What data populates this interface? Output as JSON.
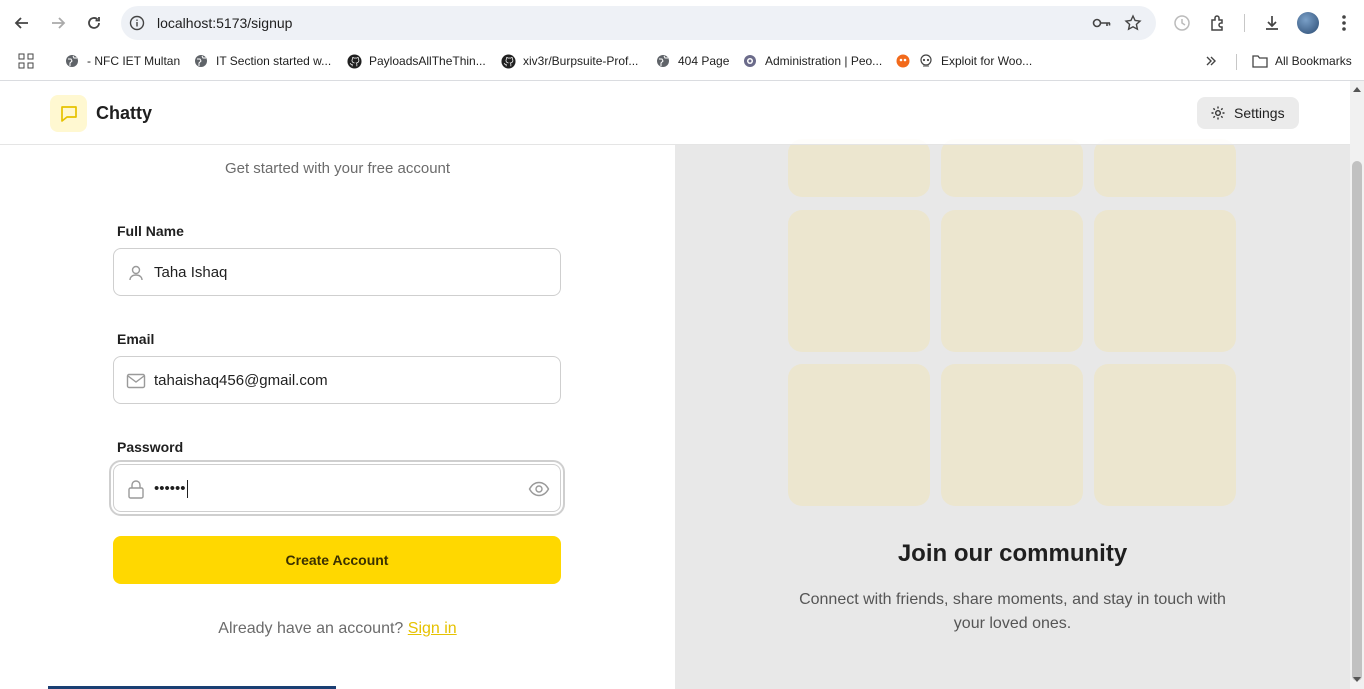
{
  "browser": {
    "url": "localhost:5173/signup",
    "bookmarks": [
      {
        "label": "- NFC IET Multan",
        "icon": "globe-icon"
      },
      {
        "label": "IT Section started w...",
        "icon": "globe-icon"
      },
      {
        "label": "PayloadsAllTheThin...",
        "icon": "github-icon"
      },
      {
        "label": "xiv3r/Burpsuite-Prof...",
        "icon": "github-icon"
      },
      {
        "label": "404 Page",
        "icon": "globe-icon"
      },
      {
        "label": "Administration | Peo...",
        "icon": "site-icon"
      },
      {
        "label": "Exploit for Woo...",
        "icon": "skull-icon"
      }
    ],
    "all_bookmarks": "All Bookmarks"
  },
  "app": {
    "brand": "Chatty",
    "settings_label": "Settings"
  },
  "signup": {
    "subtitle": "Get started with your free account",
    "full_name_label": "Full Name",
    "full_name_value": "Taha Ishaq",
    "email_label": "Email",
    "email_value": "tahaishaq456@gmail.com",
    "password_label": "Password",
    "password_value": "••••••",
    "create_button": "Create Account",
    "have_account_text": "Already have an account?",
    "sign_in_link": "Sign in"
  },
  "community": {
    "title": "Join our community",
    "subtitle": "Connect with friends, share moments, and stay in touch with your loved ones."
  },
  "colors": {
    "accent": "#ffd800",
    "panel_bg": "#e8e8e8",
    "tile": "#ece6cf"
  }
}
